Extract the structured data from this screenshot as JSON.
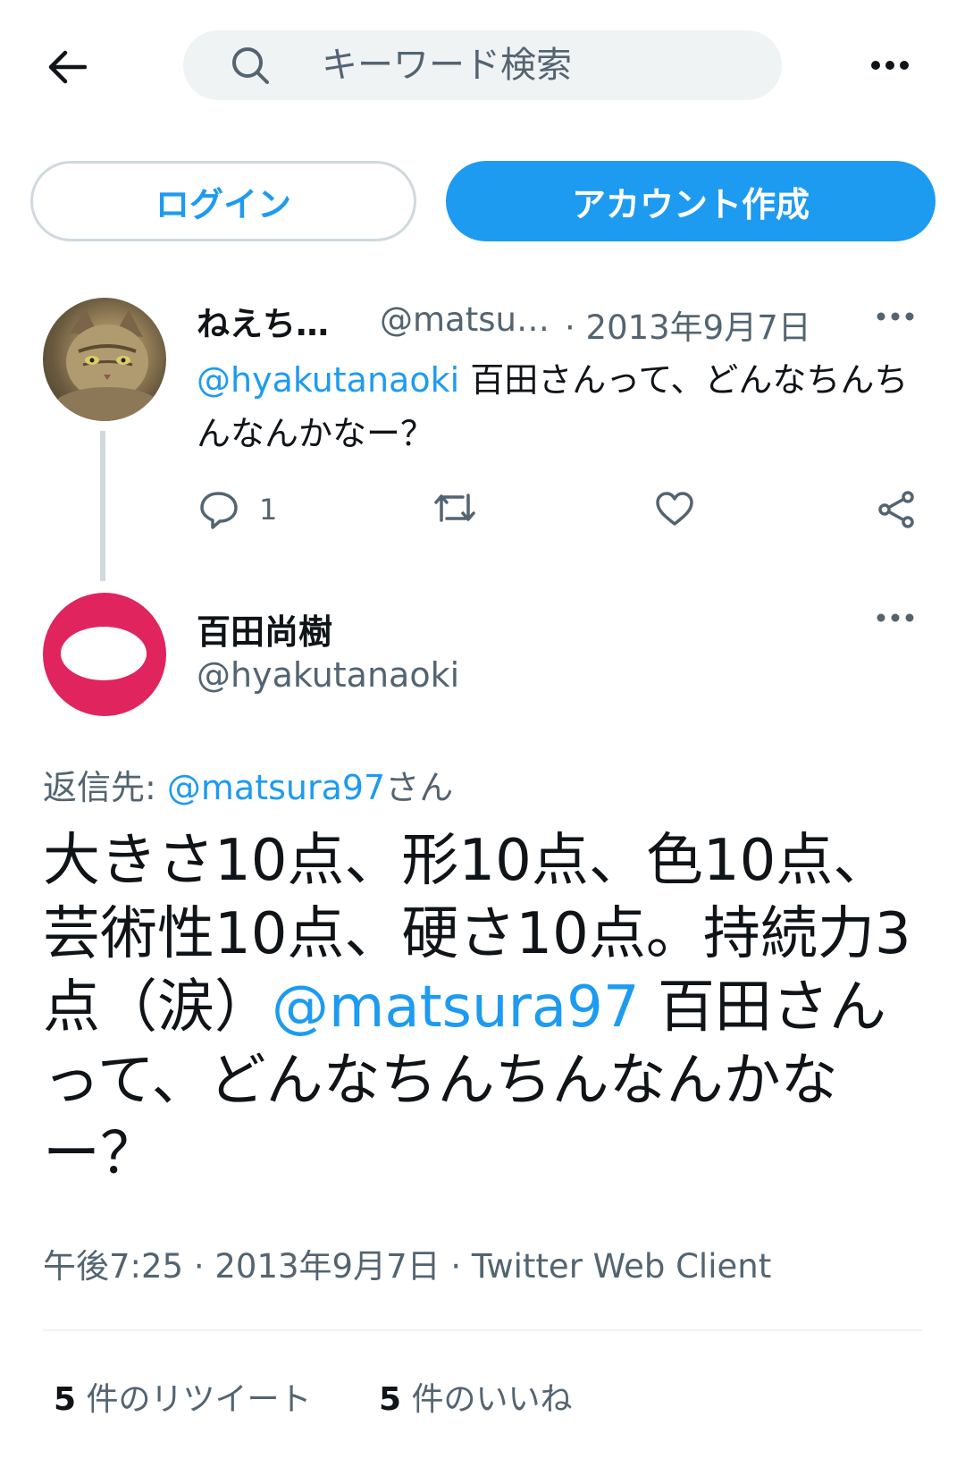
{
  "header": {
    "search_placeholder": "キーワード検索"
  },
  "auth": {
    "login_label": "ログイン",
    "signup_label": "アカウント作成"
  },
  "parent_tweet": {
    "name": "ねえち…",
    "handle": "@matsu…",
    "date": "· 2013年9月7日",
    "mention": "@hyakutanaoki",
    "text": " 百田さんって、どんなちんちんなんかなー？",
    "reply_count": "1"
  },
  "main_tweet": {
    "name": "百田尚樹",
    "handle": "@hyakutanaoki",
    "reply_prefix": "返信先: ",
    "reply_mention": "@matsura97",
    "reply_suffix": "さん",
    "text_before": "大きさ10点、形10点、色10点、芸術性10点、硬さ10点。持続力3点（涙）",
    "text_mention": "@matsura97",
    "text_after": " 百田さんって、どんなちんちんなんかなー？",
    "meta": "午後7:25 · 2013年9月7日 · Twitter Web Client",
    "retweet_count": "5",
    "retweet_label": " 件のリツイート",
    "like_count": "5",
    "like_label": " 件のいいね"
  },
  "colors": {
    "accent": "#1d9bf0",
    "secondary_text": "#536471",
    "avatar2_bg": "#e0245e"
  },
  "icons": [
    "back-arrow-icon",
    "search-icon",
    "more-horizontal-icon",
    "reply-icon",
    "retweet-icon",
    "like-icon",
    "share-icon"
  ]
}
